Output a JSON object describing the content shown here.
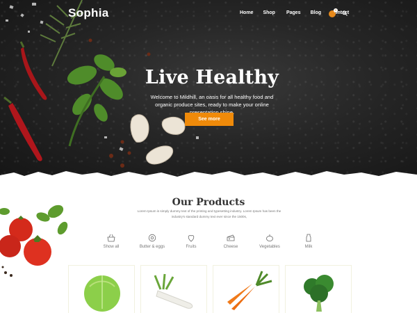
{
  "header": {
    "logo": "Sophia",
    "nav": [
      "Home",
      "Shop",
      "Pages",
      "Blog",
      "Contact"
    ],
    "cart_count": "0",
    "icons": {
      "cart": "cart-icon",
      "search": "search-icon"
    }
  },
  "hero": {
    "title": "Live Healthy",
    "text": "Welcome to Mildhill, an oasis for all healthy food and organic produce sites, ready to make your online presentation shine.",
    "button": "See more"
  },
  "products": {
    "title": "Our Products",
    "text": "Lorem Ipsum is simply dummy text of the printing and typesetting industry. Lorem Ipsum has been the industry's standard dummy text ever since the 1500s,",
    "categories": [
      {
        "label": "Show all",
        "icon": "basket-icon"
      },
      {
        "label": "Butter & eggs",
        "icon": "egg-icon"
      },
      {
        "label": "Fruits",
        "icon": "strawberry-icon"
      },
      {
        "label": "Cheese",
        "icon": "cheese-icon"
      },
      {
        "label": "Vegetables",
        "icon": "vegetable-icon"
      },
      {
        "label": "Milk",
        "icon": "milk-icon"
      }
    ],
    "cards": [
      {
        "image": "cabbage-image"
      },
      {
        "image": "radish-image"
      },
      {
        "image": "carrot-image"
      },
      {
        "image": "broccoli-image"
      }
    ]
  },
  "colors": {
    "accent": "#ef8a0a",
    "hero_bg": "#222222",
    "text": "#333333"
  }
}
